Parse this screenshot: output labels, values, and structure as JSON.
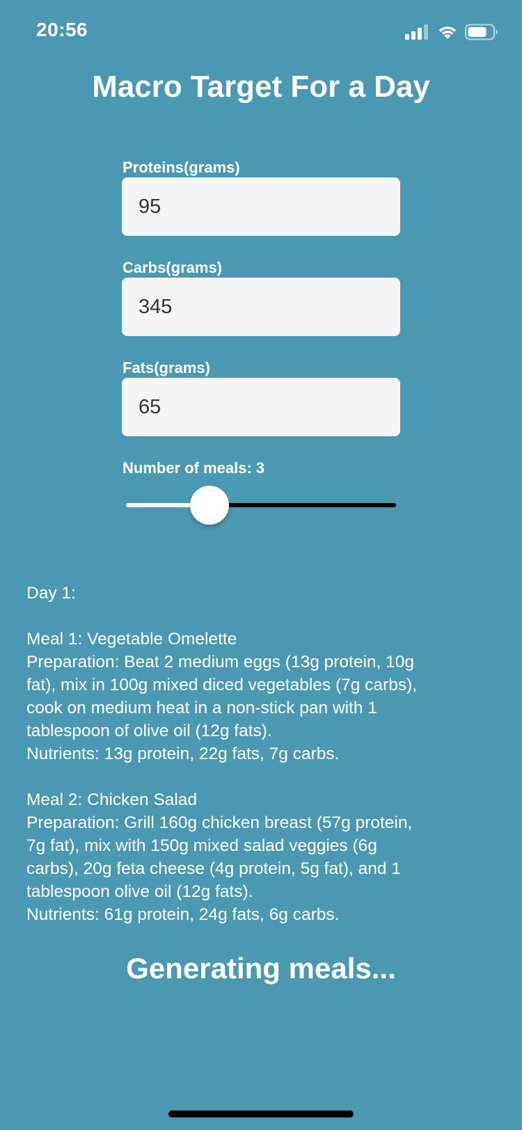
{
  "status_bar": {
    "time": "20:56",
    "icons": [
      "cellular-signal-icon",
      "wifi-icon",
      "battery-icon"
    ]
  },
  "page": {
    "title": "Macro Target For a Day"
  },
  "form": {
    "proteins": {
      "label": "Proteins(grams)",
      "value": "95"
    },
    "carbs": {
      "label": "Carbs(grams)",
      "value": "345"
    },
    "fats": {
      "label": "Fats(grams)",
      "value": "65"
    }
  },
  "meals_slider": {
    "label": "Number of meals:",
    "value": "3",
    "fraction": 0.31
  },
  "meal_plan": {
    "day_heading": "Day 1:",
    "meals": [
      {
        "lines": [
          "Meal 1: Vegetable Omelette",
          "Preparation: Beat 2 medium eggs (13g protein, 10g",
          "fat), mix in 100g mixed diced vegetables (7g carbs),",
          "cook on medium heat in a non-stick pan with 1",
          "tablespoon of olive oil (12g fats).",
          "Nutrients: 13g protein, 22g fats, 7g carbs."
        ]
      },
      {
        "lines": [
          "Meal 2: Chicken Salad",
          "Preparation: Grill 160g chicken breast (57g protein,",
          "7g fat), mix with 150g mixed salad veggies (6g",
          "carbs), 20g feta cheese (4g protein, 5g fat), and 1",
          "tablespoon olive oil (12g fats).",
          "Nutrients: 61g protein, 24g fats, 6g carbs."
        ]
      }
    ]
  },
  "status": {
    "generating": "Generating meals..."
  },
  "colors": {
    "background": "#4a98b1",
    "input_background": "#f5f5f5",
    "text": "#ffffff",
    "input_text": "#333333",
    "slider_min_track": "#ffffff",
    "slider_max_track": "#000000"
  }
}
